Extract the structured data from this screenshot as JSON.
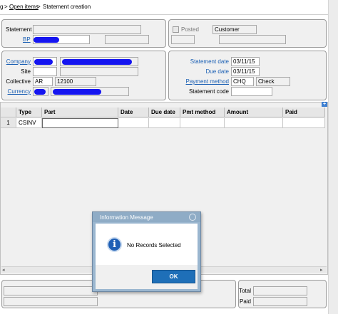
{
  "breadcrumb": {
    "home_fragment": "g",
    "separator1": ">",
    "open_items": "Open items",
    "separator2": ">",
    "current": "Statement creation"
  },
  "header_left": {
    "statement_label": "Statement",
    "bp_label": "BP"
  },
  "header_right": {
    "posted_label": "Posted",
    "customer_value": "Customer"
  },
  "company_block": {
    "company_label": "Company",
    "site_label": "Site",
    "collective_label": "Collective",
    "collective_code": "AR",
    "collective_number": "12100",
    "currency_label": "Currency"
  },
  "statement_block": {
    "statement_date_label": "Statement date",
    "statement_date": "03/11/15",
    "due_date_label": "Due date",
    "due_date": "03/11/15",
    "payment_method_label": "Payment method",
    "payment_method_code": "CHQ",
    "payment_method_name": "Check",
    "statement_code_label": "Statement code"
  },
  "grid": {
    "columns": [
      "Type",
      "Part",
      "Date",
      "Due date",
      "Pmt method",
      "Amount",
      "Paid"
    ],
    "rows": [
      {
        "num": "1",
        "type": "CSINV",
        "part": "",
        "date": "",
        "due_date": "",
        "pmt_method": "",
        "amount": "",
        "paid": ""
      }
    ],
    "add_icon": "plus-icon"
  },
  "totals": {
    "total_label": "Total",
    "paid_label": "Paid"
  },
  "dialog": {
    "title": "Information Message",
    "message": "No Records Selected",
    "ok_label": "OK",
    "icon": "info-icon",
    "close_icon": "close-icon"
  },
  "colors": {
    "accent": "#1a5fb4",
    "dialog_button": "#1e6fb8",
    "redaction": "#1515f0"
  }
}
